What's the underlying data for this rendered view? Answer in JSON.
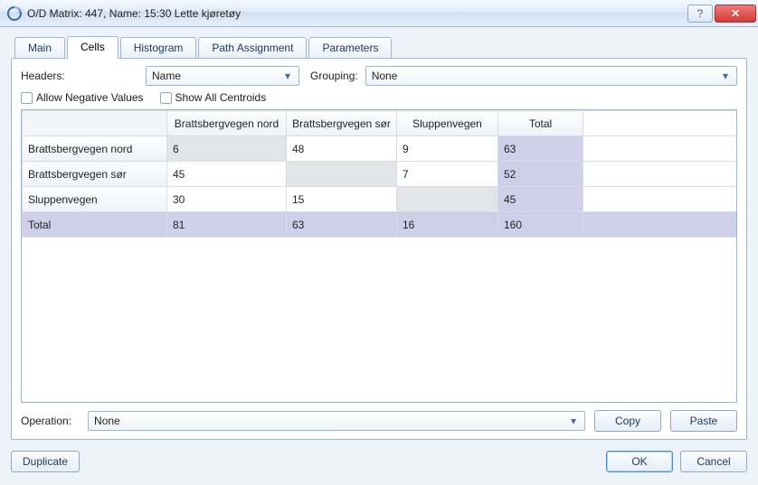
{
  "window": {
    "title": "O/D Matrix: 447, Name: 15:30 Lette kjøretøy"
  },
  "tabs": [
    "Main",
    "Cells",
    "Histogram",
    "Path Assignment",
    "Parameters"
  ],
  "active_tab": 1,
  "headers": {
    "label": "Headers:",
    "value": "Name",
    "grouping_label": "Grouping:",
    "grouping_value": "None"
  },
  "checks": {
    "allow_negative": "Allow Negative Values",
    "show_all": "Show All Centroids"
  },
  "matrix": {
    "col_headers": [
      "Brattsbergvegen nord",
      "Brattsbergvegen sør",
      "Sluppenvegen",
      "Total"
    ],
    "rows": [
      {
        "name": "Brattsbergvegen nord",
        "cells": [
          "6",
          "48",
          "9"
        ],
        "total": "63",
        "diag": 0
      },
      {
        "name": "Brattsbergvegen sør",
        "cells": [
          "45",
          "",
          "7"
        ],
        "total": "52",
        "diag": 1
      },
      {
        "name": "Sluppenvegen",
        "cells": [
          "30",
          "15",
          ""
        ],
        "total": "45",
        "diag": 2
      },
      {
        "name": "Total",
        "cells": [
          "81",
          "63",
          "16"
        ],
        "total": "160",
        "is_total": true
      }
    ]
  },
  "operation": {
    "label": "Operation:",
    "value": "None"
  },
  "buttons": {
    "copy": "Copy",
    "paste": "Paste",
    "duplicate": "Duplicate",
    "ok": "OK",
    "cancel": "Cancel"
  }
}
